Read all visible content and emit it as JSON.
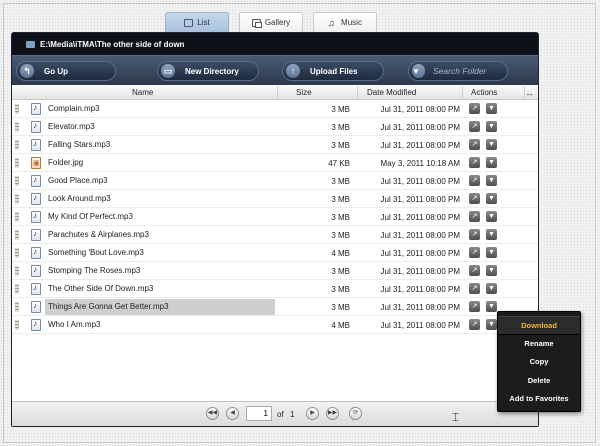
{
  "tabs": [
    {
      "label": "List",
      "icon": "list-icon"
    },
    {
      "label": "Gallery",
      "icon": "gallery-icon"
    },
    {
      "label": "Music",
      "icon": "headphones-icon"
    }
  ],
  "path": "E:\\Media\\iTMA\\The other side of down",
  "toolbar": {
    "go_up": "Go Up",
    "new_directory": "New Directory",
    "upload_files": "Upload Files",
    "search_placeholder": "Search Folder"
  },
  "columns": {
    "name": "Name",
    "size": "Size",
    "date": "Date Modified",
    "actions": "Actions"
  },
  "files": [
    {
      "name": "Complain.mp3",
      "size": "3 MB",
      "date": "Jul 31, 2011 08:00 PM",
      "type": "audio"
    },
    {
      "name": "Elevator.mp3",
      "size": "3 MB",
      "date": "Jul 31, 2011 08:00 PM",
      "type": "audio"
    },
    {
      "name": "Falling Stars.mp3",
      "size": "3 MB",
      "date": "Jul 31, 2011 08:00 PM",
      "type": "audio"
    },
    {
      "name": "Folder.jpg",
      "size": "47 KB",
      "date": "May 3, 2011 10:18 AM",
      "type": "image"
    },
    {
      "name": "Good Place.mp3",
      "size": "3 MB",
      "date": "Jul 31, 2011 08:00 PM",
      "type": "audio"
    },
    {
      "name": "Look Around.mp3",
      "size": "3 MB",
      "date": "Jul 31, 2011 08:00 PM",
      "type": "audio"
    },
    {
      "name": "My Kind Of Perfect.mp3",
      "size": "3 MB",
      "date": "Jul 31, 2011 08:00 PM",
      "type": "audio"
    },
    {
      "name": "Parachutes & Airplanes.mp3",
      "size": "3 MB",
      "date": "Jul 31, 2011 08:00 PM",
      "type": "audio"
    },
    {
      "name": "Something 'Bout Love.mp3",
      "size": "4 MB",
      "date": "Jul 31, 2011 08:00 PM",
      "type": "audio"
    },
    {
      "name": "Stomping The Roses.mp3",
      "size": "3 MB",
      "date": "Jul 31, 2011 08:00 PM",
      "type": "audio"
    },
    {
      "name": "The Other Side Of Down.mp3",
      "size": "3 MB",
      "date": "Jul 31, 2011 08:00 PM",
      "type": "audio"
    },
    {
      "name": "Things Are Gonna Get Better.mp3",
      "size": "3 MB",
      "date": "Jul 31, 2011 08:00 PM",
      "type": "audio",
      "selected": true
    },
    {
      "name": "Who I Am.mp3",
      "size": "4 MB",
      "date": "Jul 31, 2011 08:00 PM",
      "type": "audio"
    }
  ],
  "pager": {
    "current": "1",
    "of": "of",
    "total": "1"
  },
  "context_menu": [
    "Download",
    "Rename",
    "Copy",
    "Delete",
    "Add to Favorites"
  ],
  "colors": {
    "toolbar": "#2c394c",
    "path_bar": "#0d1016",
    "menu_highlight": "#f5b42a",
    "active_tab": "#a9c2dd"
  }
}
